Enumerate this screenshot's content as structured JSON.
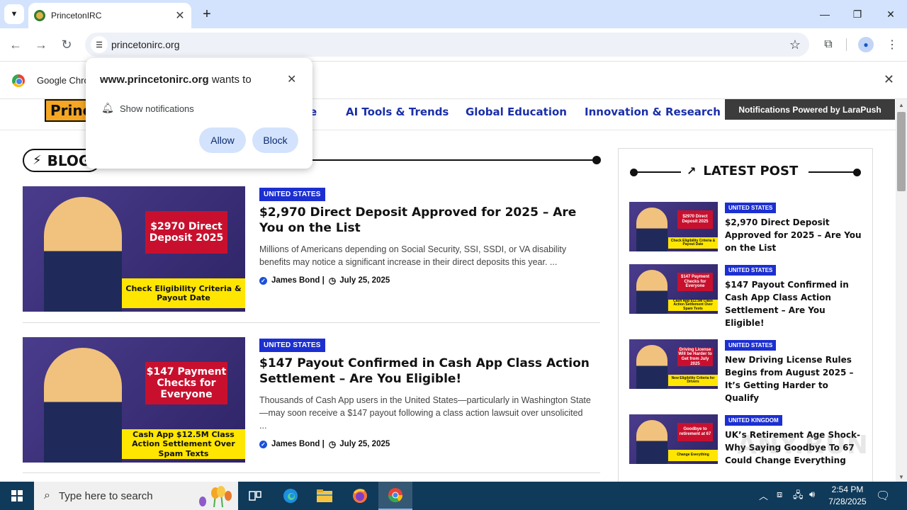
{
  "browser": {
    "tab_title": "PrincetonIRC",
    "url": "princetonirc.org",
    "infobar_text": "Google Chro",
    "icons": [
      "tab-search-icon",
      "close-icon",
      "plus-icon",
      "minimize-icon",
      "maximize-icon",
      "back-arrow-icon",
      "forward-arrow-icon",
      "reload-icon",
      "site-info-icon",
      "star-icon",
      "extensions-icon",
      "profile-icon",
      "kebab-menu-icon"
    ]
  },
  "popup": {
    "site": "www.princetonirc.org",
    "suffix": "wants to",
    "permission": "Show notifications",
    "allow": "Allow",
    "block": "Block"
  },
  "site": {
    "logo_text": "Princ",
    "nav_partial": "e",
    "nav": [
      "AI Tools & Trends",
      "Global Education",
      "Innovation & Research"
    ],
    "lara_banner": "Notifications Powered by LaraPush",
    "section_title": "BLOG",
    "accent": "#1c2fd1"
  },
  "articles": [
    {
      "badge": "UNITED STATES",
      "title": "$2,970 Direct Deposit Approved for 2025 – Are You on the List",
      "excerpt": "Millions of Americans depending on Social Security, SSI, SSDI, or VA disability benefits may notice a significant increase in their direct deposits this year. ...",
      "author": "James Bond |",
      "date": "July 25, 2025",
      "thumb_box": "$2970 Direct Deposit 2025",
      "thumb_banner": "Check Eligibility Criteria & Payout Date"
    },
    {
      "badge": "UNITED STATES",
      "title": "$147 Payout Confirmed in Cash App Class Action Settlement – Are You Eligible!",
      "excerpt": "Thousands of Cash App users in the United States—particularly in Washington State—may soon receive a $147 payout following a class action lawsuit over unsolicited ...",
      "author": "James Bond |",
      "date": "July 25, 2025",
      "thumb_box": "$147 Payment Checks for Everyone",
      "thumb_banner": "Cash App $12.5M Class Action Settlement Over Spam Texts"
    }
  ],
  "sidebar": {
    "title": "LATEST POST",
    "posts": [
      {
        "badge": "UNITED STATES",
        "title": "$2,970 Direct Deposit Approved for 2025 – Are You on the List",
        "thumb_box": "$2970 Direct Deposit 2025",
        "thumb_banner": "Check Eligibility Criteria & Payout Date"
      },
      {
        "badge": "UNITED STATES",
        "title": "$147 Payout Confirmed in Cash App Class Action Settlement – Are You Eligible!",
        "thumb_box": "$147 Payment Checks for Everyone",
        "thumb_banner": "Cash App $12.5M Class Action Settlement Over Spam Texts"
      },
      {
        "badge": "UNITED STATES",
        "title": "New Driving License Rules Begins from August 2025 – It’s Getting Harder to Qualify",
        "thumb_box": "Driving License Will be Harder to Get from July 2025",
        "thumb_banner": "New Eligibility Criteria for Drivers"
      },
      {
        "badge": "UNITED KINGDOM",
        "title": "UK’s Retirement Age Shock- Why Saying Goodbye To 67 Could Change Everything",
        "thumb_box": "Goodbye to retirement at 67",
        "thumb_banner": "Change Everything"
      }
    ]
  },
  "taskbar": {
    "search_placeholder": "Type here to search",
    "time": "2:54 PM",
    "date": "7/28/2025"
  }
}
